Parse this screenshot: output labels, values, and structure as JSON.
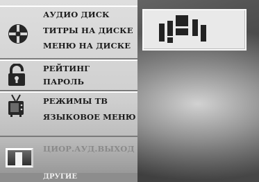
{
  "menu": {
    "disc_group": {
      "icon": "disc-icon",
      "items": [
        {
          "label": "АУДИО ДИСК"
        },
        {
          "label": "ТИТРЫ НА ДИСКЕ"
        },
        {
          "label": "МЕНЮ НА ДИСКЕ"
        }
      ]
    },
    "rating_group": {
      "icon": "lock-icon",
      "items": [
        {
          "label": "РЕЙТИНГ"
        },
        {
          "label": "ПАРОЛЬ"
        }
      ]
    },
    "tv_group": {
      "icon": "tv-icon",
      "items": [
        {
          "label": "РЕЖИМЫ ТВ"
        },
        {
          "label": "ЯЗЫКОВОЕ МЕНЮ"
        }
      ]
    },
    "audio_group": {
      "icon": "audio-output-icon",
      "items": [
        {
          "label": "ЦИОР.АУД.ВЫХОД"
        }
      ]
    },
    "other_group": {
      "items": [
        {
          "label": "ДРУГИЕ"
        }
      ]
    }
  },
  "preview": {
    "icon": "speaker-layout-icon"
  },
  "colors": {
    "panel": "#d8d8d8",
    "text": "#1c1c1c",
    "dim_text": "#8a8a8a",
    "highlight": "#ffffff"
  }
}
